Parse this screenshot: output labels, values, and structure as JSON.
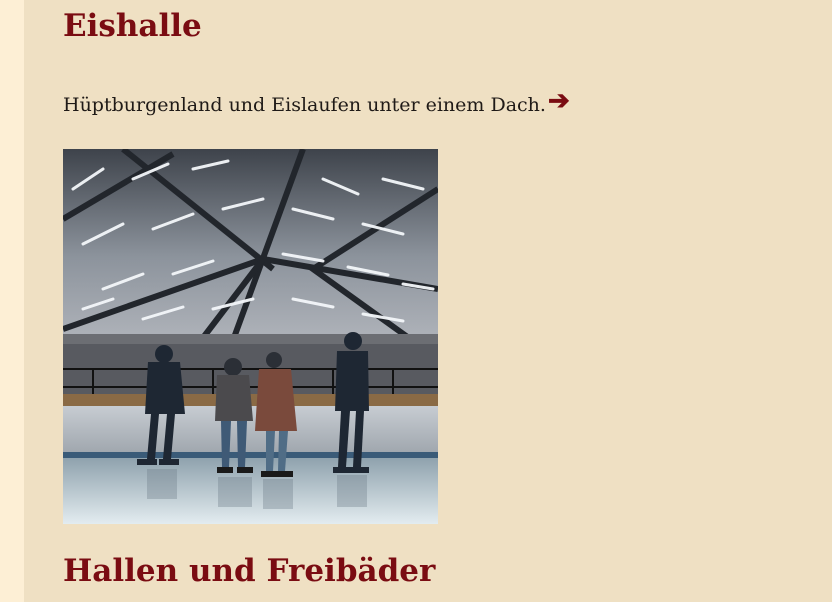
{
  "page": {
    "title": "Eishalle",
    "intro_text": "Hüptburgenland und Eislaufen unter einem Dach.",
    "arrow_glyph": "➔",
    "next_section_title": "Hallen und Freibäder"
  },
  "image": {
    "subject": "Ice rink with four skaters under a lit hall roof"
  },
  "colors": {
    "sidebar_bg": "#fdefd5",
    "content_bg": "#efe0c3",
    "heading": "#7a0c12",
    "text": "#1f1a17"
  }
}
